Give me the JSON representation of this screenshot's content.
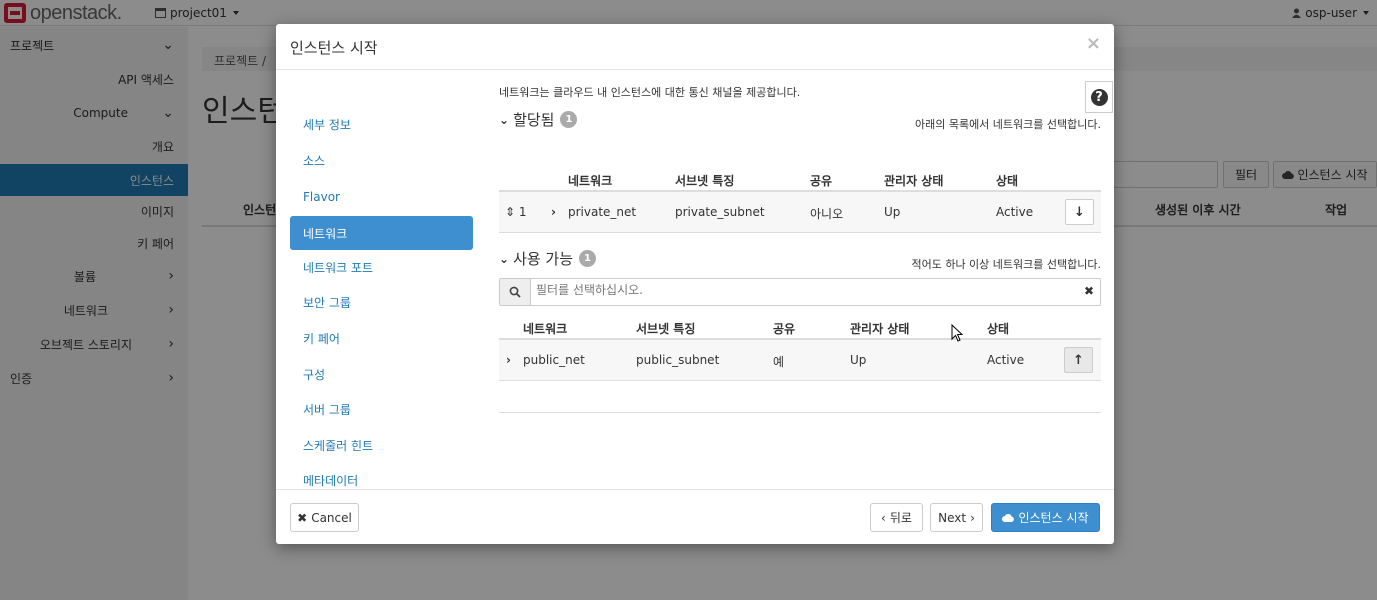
{
  "topbar": {
    "logo_text": "openstack.",
    "project": "project01",
    "user": "osp-user"
  },
  "sidebar": {
    "items": [
      {
        "label": "프로젝트",
        "level": "top",
        "chevron": "down"
      },
      {
        "label": "API 액세스",
        "level": "sub"
      },
      {
        "label": "Compute",
        "level": "sub",
        "chevron": "down"
      },
      {
        "label": "개요",
        "level": "sub"
      },
      {
        "label": "인스턴스",
        "level": "sub",
        "active": true
      },
      {
        "label": "이미지",
        "level": "sub"
      },
      {
        "label": "키 페어",
        "level": "sub"
      },
      {
        "label": "볼륨",
        "level": "sub",
        "chevron": "right"
      },
      {
        "label": "네트워크",
        "level": "sub",
        "chevron": "right"
      },
      {
        "label": "오브젝트 스토리지",
        "level": "sub",
        "chevron": "right"
      },
      {
        "label": "인증",
        "level": "top",
        "chevron": "right"
      }
    ]
  },
  "background": {
    "breadcrumb": "프로젝트 /",
    "page_title": "인스턴",
    "filter_button": "필터",
    "launch_button": "인스턴스 시작",
    "col_instance": "인스턴",
    "col_age": "생성된 이후 시간",
    "col_actions": "작업"
  },
  "modal": {
    "title": "인스턴스 시작",
    "close_icon": "×",
    "steps": [
      {
        "label": "세부 정보"
      },
      {
        "label": "소스"
      },
      {
        "label": "Flavor"
      },
      {
        "label": "네트워크",
        "active": true
      },
      {
        "label": "네트워크 포트"
      },
      {
        "label": "보안 그룹"
      },
      {
        "label": "키 페어"
      },
      {
        "label": "구성"
      },
      {
        "label": "서버 그룹"
      },
      {
        "label": "스케줄러 힌트"
      },
      {
        "label": "메타데이터"
      }
    ],
    "description": "네트워크는 클라우드 내 인스턴스에 대한 통신 채널을 제공합니다.",
    "allocated": {
      "title": "할당됨",
      "count": "1",
      "hint": "아래의 목록에서 네트워크를 선택합니다.",
      "columns": [
        "네트워크",
        "서브넷 특징",
        "공유",
        "관리자 상태",
        "상태"
      ],
      "rows": [
        {
          "order": "1",
          "network": "private_net",
          "subnets": "private_subnet",
          "shared": "아니오",
          "admin_state": "Up",
          "status": "Active"
        }
      ]
    },
    "available": {
      "title": "사용 가능",
      "count": "1",
      "hint": "적어도 하나 이상 네트워크를 선택합니다.",
      "filter_placeholder": "필터를 선택하십시오.",
      "columns": [
        "네트워크",
        "서브넷 특징",
        "공유",
        "관리자 상태",
        "상태"
      ],
      "rows": [
        {
          "network": "public_net",
          "subnets": "public_subnet",
          "shared": "예",
          "admin_state": "Up",
          "status": "Active"
        }
      ]
    },
    "footer": {
      "cancel": "Cancel",
      "back": "뒤로",
      "next": "Next",
      "launch": "인스턴스 시작"
    }
  },
  "colors": {
    "accent": "#3d8fd0",
    "sidebar_active": "#1f7ab4",
    "brand_red": "#da1a32"
  }
}
